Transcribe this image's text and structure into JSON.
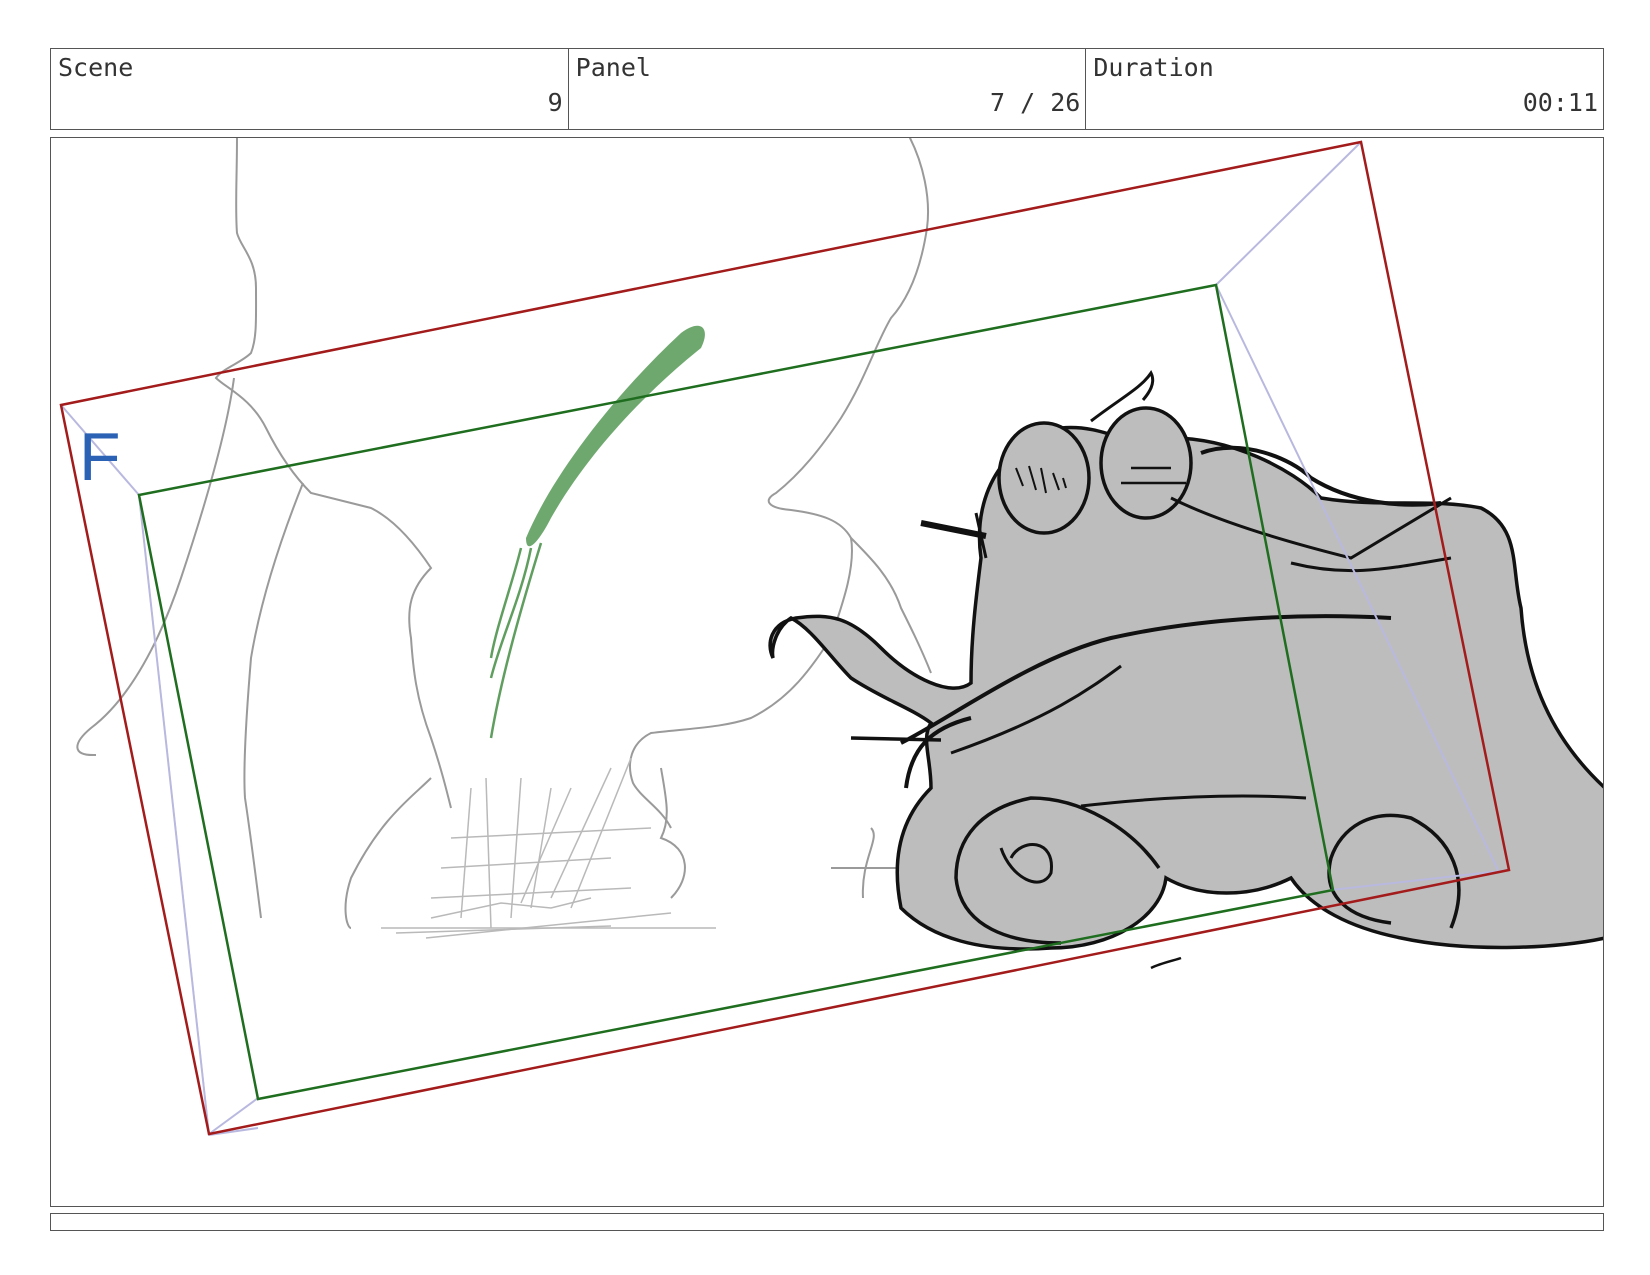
{
  "header": {
    "scene_label": "Scene",
    "scene_value": "9",
    "panel_label": "Panel",
    "panel_value": "7 / 26",
    "duration_label": "Duration",
    "duration_value": "00:11"
  },
  "frame": {
    "marker": "F",
    "outer_color": "#a31b1b",
    "inner_color": "#1f6e1f",
    "guide_color": "#b9b9e0",
    "marker_color": "#2b62b5"
  },
  "sketch": {
    "fill_color": "#bdbdbd",
    "ink_color": "#111111",
    "sketch_color": "#9a9a9a",
    "leaf_color": "#5f9e5f"
  }
}
